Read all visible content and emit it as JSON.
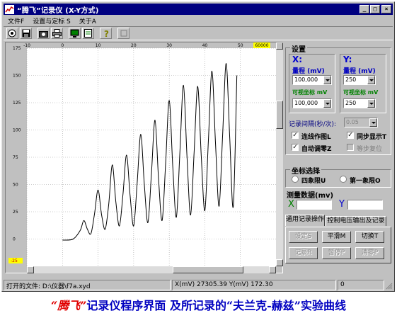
{
  "window": {
    "title": "“腾飞”记录仪 (X-Y方式)",
    "buttons": [
      "_",
      "□",
      "×"
    ]
  },
  "menu": [
    "文件F",
    "设置与定标 S",
    "关于A"
  ],
  "toolbar": {
    "icons": [
      "open-icon",
      "save-icon",
      "camera-icon",
      "print-icon",
      "monitor-icon",
      "document-icon",
      "help-icon",
      "stop-icon"
    ]
  },
  "chart_data": {
    "type": "line",
    "xlim": [
      -10,
      60
    ],
    "ylim": [
      -25,
      175
    ],
    "x_ticks": [
      "-10",
      "0",
      "10",
      "20",
      "30",
      "40",
      "50"
    ],
    "x_max_label": "60000",
    "y_ticks": [
      "175",
      "150",
      "125",
      "100",
      "75",
      "50",
      "25",
      "0"
    ],
    "y_min_label": "-25",
    "grid": true,
    "line_color": "#000000",
    "series": [
      {
        "x": [
          0.0,
          3.0,
          5.0,
          6.0,
          7.0,
          8.0,
          9.0,
          10.0,
          11.0,
          12.0,
          13.0,
          14.0,
          15.0,
          16.0,
          17.0,
          18.0,
          19.0,
          20.0,
          21.0,
          22.0,
          23.0,
          24.0,
          25.0,
          26.0,
          27.0,
          28.0,
          29.0,
          30.0,
          31.0,
          32.0,
          33.0,
          34.0,
          35.0,
          36.0,
          37.0,
          38.0,
          39.0,
          40.0,
          41.0,
          42.0,
          43.0,
          44.0,
          45.0,
          46.0,
          47.0,
          48.0,
          49.0
        ],
        "y": [
          -1,
          0,
          8,
          17,
          9,
          5,
          23,
          45,
          22,
          9,
          32,
          68,
          34,
          12,
          41,
          77,
          40,
          12,
          52,
          96,
          50,
          15,
          60,
          109,
          55,
          17,
          70,
          127,
          66,
          20,
          80,
          141,
          75,
          22,
          80,
          140,
          76,
          26,
          90,
          154,
          88,
          30,
          95,
          161,
          93,
          30,
          150
        ]
      }
    ]
  },
  "status": {
    "file": "打开的文件: D:\\仪器\\f7a.xyd",
    "readout": "X(mV) 27305.39   Y(mV) 172.30",
    "extra": "0"
  },
  "panel": {
    "settings_title": "设置",
    "x_axis": "X:",
    "y_axis": "Y:",
    "range_label": "量程 (mV)",
    "visible_label": "可视坐标 mV",
    "x_range": "100,000",
    "x_visible": "100,000",
    "y_range": "250",
    "y_visible": "250",
    "interval_label": "记录间隔(秒/次):",
    "interval_value": "0.05",
    "chk_connect": "连线作图L",
    "chk_sync": "同步显示T",
    "chk_autozero": "自动调零Z",
    "chk_stepreset": "等步复位",
    "coord_title": "坐标选择",
    "radio_four": "四象限U",
    "radio_first": "第一象限O",
    "measure_title": "测量数据(mv)",
    "measure_x": "X",
    "measure_y": "Y",
    "tab_general": "通用记录操作",
    "tab_control": "控制电压输出及记录",
    "btn_set": "设定S",
    "btn_smooth": "平滑M",
    "btn_switch": "切换T",
    "btn_record": "记录R",
    "btn_pause": "暂停P",
    "btn_clear": "清零P"
  },
  "caption": {
    "highlight": "“腾飞”",
    "text": "记录仪程序界面  及所记录的“夫兰克-赫兹”实验曲线"
  }
}
